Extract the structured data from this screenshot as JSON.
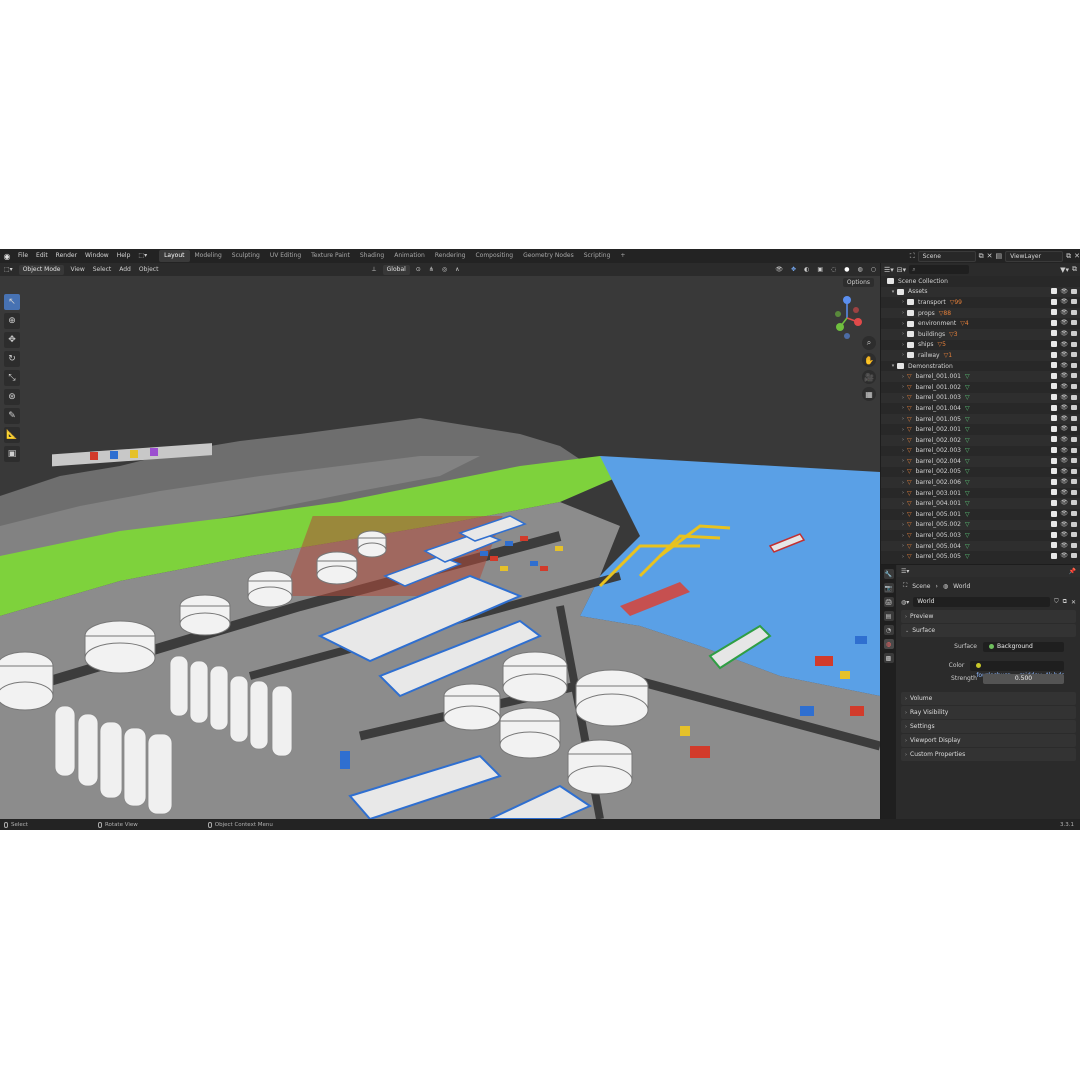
{
  "topbar": {
    "menus": [
      "File",
      "Edit",
      "Render",
      "Window",
      "Help"
    ],
    "workspaces": [
      "Layout",
      "Modeling",
      "Sculpting",
      "UV Editing",
      "Texture Paint",
      "Shading",
      "Animation",
      "Rendering",
      "Compositing",
      "Geometry Nodes",
      "Scripting"
    ],
    "active_workspace": "Layout",
    "add_tab": "+",
    "scene_field": "Scene",
    "view_layer_field": "ViewLayer"
  },
  "viewport_header": {
    "mode": "Object Mode",
    "menus": [
      "View",
      "Select",
      "Add",
      "Object"
    ],
    "transform_orientation": "Global",
    "options": "Options"
  },
  "outliner": {
    "root": "Scene Collection",
    "collections": [
      {
        "name": "Assets",
        "children": [
          {
            "name": "transport",
            "badge": "99"
          },
          {
            "name": "props",
            "badge": "88"
          },
          {
            "name": "environment",
            "badge": "4"
          },
          {
            "name": "buildings",
            "badge": "3"
          },
          {
            "name": "ships",
            "badge": "5"
          },
          {
            "name": "railway",
            "badge": "1"
          }
        ]
      },
      {
        "name": "Demonstration",
        "children": [
          {
            "name": "barrel_001.001"
          },
          {
            "name": "barrel_001.002"
          },
          {
            "name": "barrel_001.003"
          },
          {
            "name": "barrel_001.004"
          },
          {
            "name": "barrel_001.005"
          },
          {
            "name": "barrel_002.001"
          },
          {
            "name": "barrel_002.002"
          },
          {
            "name": "barrel_002.003"
          },
          {
            "name": "barrel_002.004"
          },
          {
            "name": "barrel_002.005"
          },
          {
            "name": "barrel_002.006"
          },
          {
            "name": "barrel_003.001"
          },
          {
            "name": "barrel_004.001"
          },
          {
            "name": "barrel_005.001"
          },
          {
            "name": "barrel_005.002"
          },
          {
            "name": "barrel_005.003"
          },
          {
            "name": "barrel_005.004"
          },
          {
            "name": "barrel_005.005"
          }
        ]
      }
    ]
  },
  "properties": {
    "breadcrumb": [
      "Scene",
      "World"
    ],
    "world_name": "World",
    "panels": {
      "preview": "Preview",
      "surface": "Surface",
      "volume": "Volume",
      "ray_visibility": "Ray Visibility",
      "settings": "Settings",
      "viewport_display": "Viewport Display",
      "custom_properties": "Custom Properties"
    },
    "surface_label": "Surface",
    "surface_value": "Background",
    "color_label": "Color",
    "color_value": "fourlesburg_...midday_4k.hdr",
    "strength_label": "Strength",
    "strength_value": "0.500"
  },
  "statusbar": {
    "select": "Select",
    "rotate": "Rotate View",
    "context": "Object Context Menu",
    "version": "3.3.1"
  },
  "colors": {
    "accent": "#4772b3",
    "water": "#5aa0e6",
    "grass": "#7ed23c",
    "object_orange": "#e8813a"
  }
}
